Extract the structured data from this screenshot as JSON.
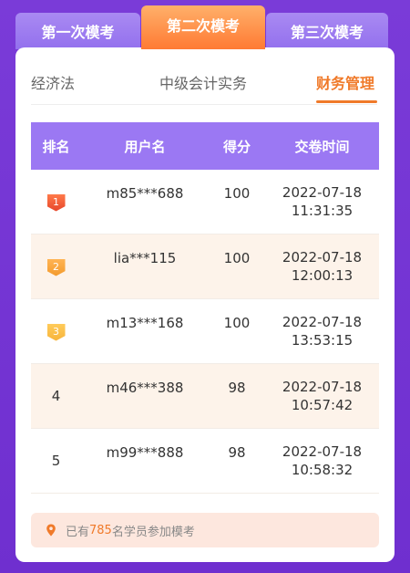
{
  "top_tabs": [
    "第一次模考",
    "第二次模考",
    "第三次模考"
  ],
  "sub_tabs": [
    "经济法",
    "中级会计实务",
    "财务管理"
  ],
  "table": {
    "headers": [
      "排名",
      "用户名",
      "得分",
      "交卷时间"
    ],
    "rows": [
      {
        "rank": "1",
        "user": "m85***688",
        "score": "100",
        "date": "2022-07-18",
        "time": "11:31:35"
      },
      {
        "rank": "2",
        "user": "lia***115",
        "score": "100",
        "date": "2022-07-18",
        "time": "12:00:13"
      },
      {
        "rank": "3",
        "user": "m13***168",
        "score": "100",
        "date": "2022-07-18",
        "time": "13:53:15"
      },
      {
        "rank": "4",
        "user": "m46***388",
        "score": "98",
        "date": "2022-07-18",
        "time": "10:57:42"
      },
      {
        "rank": "5",
        "user": "m99***888",
        "score": "98",
        "date": "2022-07-18",
        "time": "10:58:32"
      }
    ]
  },
  "footer": {
    "prefix": "已有",
    "count": "785",
    "suffix": "名学员参加模考",
    "icon": "location-pin-icon"
  },
  "colors": {
    "accent": "#f07a2a",
    "header": "#9b78f3",
    "background": "#7a3bd8"
  }
}
